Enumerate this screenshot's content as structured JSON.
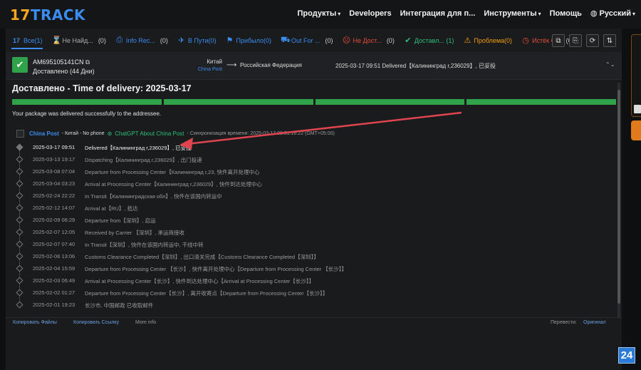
{
  "logo": {
    "num": "17",
    "text": "TRACK"
  },
  "nav": [
    {
      "label": "Продукты",
      "caret": true
    },
    {
      "label": "Developers",
      "caret": false
    },
    {
      "label": "Интеграция для п...",
      "caret": false
    },
    {
      "label": "Инструменты",
      "caret": true
    },
    {
      "label": "Помощь",
      "caret": false
    },
    {
      "label": "Русский",
      "caret": true
    }
  ],
  "filters": [
    {
      "label": "Все(1)",
      "icon": "17",
      "color": "#3b8cf0",
      "count": "",
      "active": true
    },
    {
      "label": "Не Найд...",
      "icon": "⌛",
      "color": "#aaaaaa",
      "count": "(0)"
    },
    {
      "label": "Info Rec...",
      "icon": "⎙",
      "color": "#3b8cf0",
      "count": "(0)"
    },
    {
      "label": "В Пути(0)",
      "icon": "✈",
      "color": "#3b8cf0",
      "count": ""
    },
    {
      "label": "Прибыло(0)",
      "icon": "⚑",
      "color": "#3b8cf0",
      "count": ""
    },
    {
      "label": "Out For ...",
      "icon": "⛟",
      "color": "#3b8cf0",
      "count": "(0)"
    },
    {
      "label": "Не Дост...",
      "icon": "☹",
      "color": "#e74c3c",
      "count": "(0)"
    },
    {
      "label": "Доставл... (1)",
      "icon": "✔",
      "color": "#2fbf7a",
      "count": ""
    },
    {
      "label": "Проблема(0)",
      "icon": "⚠",
      "color": "#f39c12",
      "count": ""
    },
    {
      "label": "Истёк С...",
      "icon": "◷",
      "color": "#e74c3c",
      "count": "(0)"
    }
  ],
  "tools": [
    "⧉",
    "⎘",
    "⟳",
    "⇅"
  ],
  "shipment": {
    "tracking_number": "AM695105141CN",
    "status": "Доставлено (44 Дни)",
    "origin": "Китай",
    "origin_carrier": "China Post",
    "destination": "Российская Федерация",
    "latest": "2025-03-17 09:51  Delivered【Калининград r,236029】, 已妥投"
  },
  "detail": {
    "title": "Доставлено - Time of delivery:  2025-03-17",
    "message": "Your package was delivered successfully to the addressee.",
    "carrier_name": "China Post",
    "carrier_meta": "- Китай - No phone",
    "chatgpt": "ChatGPT About China Post",
    "sync": "- Синхронизация времени: 2025-03-17 09:51:16:22 (GMT+05:00)"
  },
  "events": [
    {
      "time": "2025-03-17 09:51",
      "desc": "Delivered【Калининград r,236029】, 已妥投"
    },
    {
      "time": "2025-03-13 19:17",
      "desc": "Dispatching【Калининград r,236029】, 出门投递"
    },
    {
      "time": "2025-03-08 07:04",
      "desc": "Departure from Processing Center【Калининград r,23, 快件离开处理中心"
    },
    {
      "time": "2025-03-04 03:23",
      "desc": "Arrival at Processing Center【Калининград r,236029】, 快件到达处理中心"
    },
    {
      "time": "2025-02-24 22:22",
      "desc": "In Transit【Калининградская обл】, 快件在该国内转运中"
    },
    {
      "time": "2025-02-12 14:07",
      "desc": "Arrival at【RU】, 抵达"
    },
    {
      "time": "2025-02-09 06:29",
      "desc": "Departure from【深圳】, 启运"
    },
    {
      "time": "2025-02-07 12:05",
      "desc": "Received by Carrier 【深圳】, 承运商接收"
    },
    {
      "time": "2025-02-07 07:40",
      "desc": "In Transit【深圳】, 快件在该国内转运中, 干线中转"
    },
    {
      "time": "2025-02-06 13:06",
      "desc": "Customs Clearance Completed【深圳】, 出口清关完成【Customs Clearance Completed【深圳】】"
    },
    {
      "time": "2025-02-04 15:59",
      "desc": "Departure from Processing Center 【长沙】, 快件离开处理中心【Departure from Processing Center 【长沙】】"
    },
    {
      "time": "2025-02-03 06:49",
      "desc": "Arrival at Processing Center【长沙】, 快件到达处理中心【Arrival at Processing Center【长沙】】"
    },
    {
      "time": "2025-02-02 01:27",
      "desc": "Departure from Processing Center【长沙】, 离开收寄点【Departure from Processing Center【长沙】】"
    },
    {
      "time": "2025-02-01 19:23",
      "desc": "长沙市, 中国邮政 已收取邮件"
    }
  ],
  "footer": {
    "copy_files": "Копировать Файлы",
    "copy_links": "Копировать Ссылку",
    "more": "More info",
    "translate": "Перевести:",
    "original": "Оригинал"
  },
  "badge": "24",
  "colors": {
    "accent": "#3b8cf0",
    "success": "#2fa24a",
    "arrow": "#e0454f"
  }
}
